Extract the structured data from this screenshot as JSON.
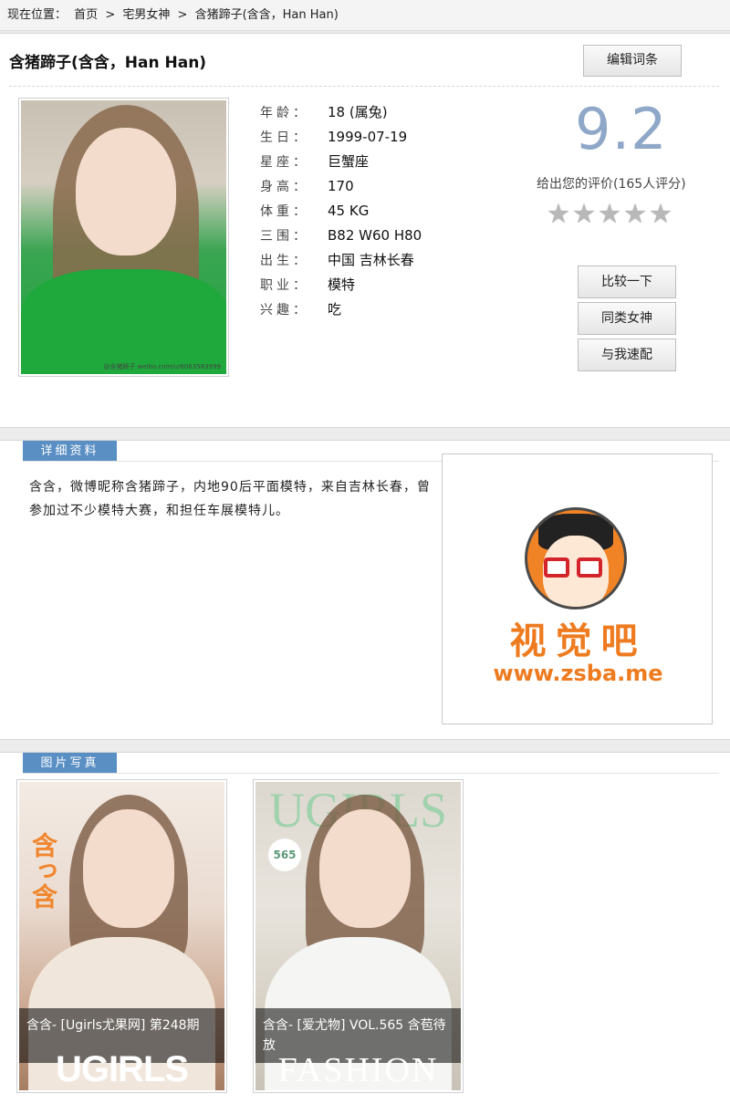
{
  "breadcrumb": {
    "prefix": "现在位置：",
    "items": [
      "首页",
      "宅男女神",
      "含猪蹄子(含含，Han Han)"
    ],
    "sep": ">"
  },
  "profile": {
    "name": "含猪蹄子(含含，Han Han)",
    "edit_label": "编辑词条",
    "photo_watermark": "@含猪蹄子 weibo.com/u/6063583999",
    "fields": [
      {
        "label": "年龄：",
        "value": "18 (属兔)"
      },
      {
        "label": "生日：",
        "value": "1999-07-19"
      },
      {
        "label": "星座：",
        "value": "巨蟹座"
      },
      {
        "label": "身高：",
        "value": "170"
      },
      {
        "label": "体重：",
        "value": "45 KG"
      },
      {
        "label": "三围：",
        "value": "B82 W60 H80"
      },
      {
        "label": "出生：",
        "value": "中国 吉林长春"
      },
      {
        "label": "职业：",
        "value": "模特"
      },
      {
        "label": "兴趣：",
        "value": "吃"
      }
    ],
    "score": "9.2",
    "rating_text": "给出您的评价(165人评分)",
    "stars": 5,
    "buttons": [
      "比较一下",
      "同类女神",
      "与我速配"
    ]
  },
  "details": {
    "header": "详细资料",
    "text": "含含，微博昵称含猪蹄子，内地90后平面模特，来自吉林长春，曾参加过不少模特大赛，和担任车展模特儿。",
    "logo_cn": "视觉吧",
    "logo_url": "www.zsba.me"
  },
  "gallery": {
    "header": "图片写真",
    "items": [
      {
        "caption": "含含- [Ugirls尤果网] 第248期",
        "cover_word": "UGIRLS",
        "cover_side": "含っ含"
      },
      {
        "caption": "含含- [爱尤物] VOL.565 含苞待放",
        "cover_word": "FASHION",
        "cover_top": "UGIRLS",
        "cover_vol": "565"
      }
    ]
  },
  "colors": {
    "accent": "#5a8fc4",
    "score": "#8fa8c8",
    "logo": "#ee7b1f"
  }
}
